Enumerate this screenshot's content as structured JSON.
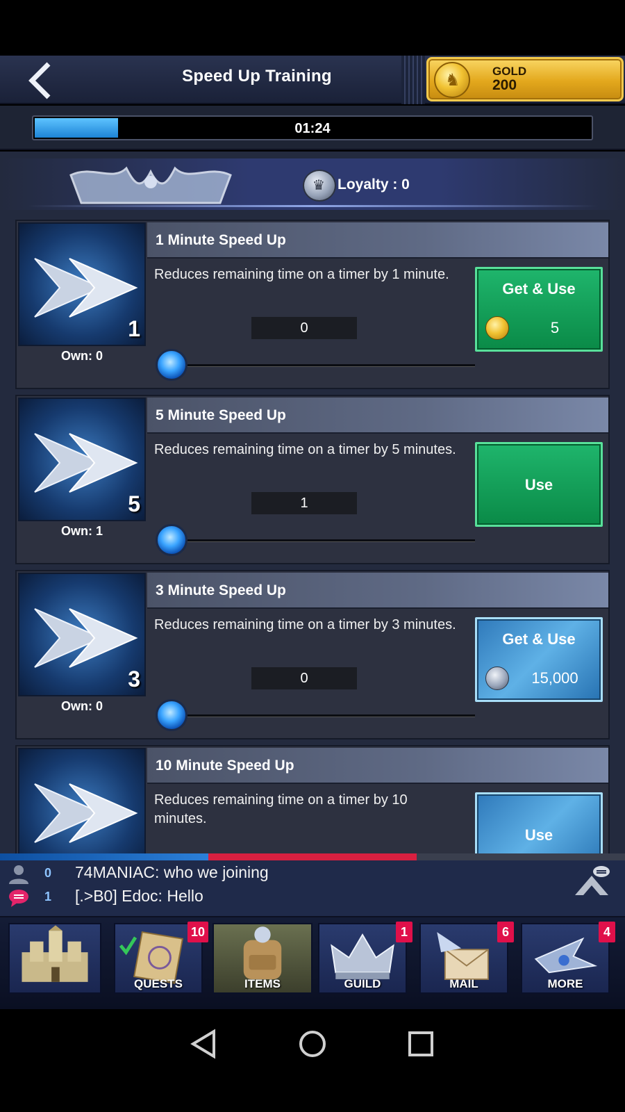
{
  "header": {
    "title": "Speed Up Training",
    "gold_label": "GOLD",
    "gold_value": "200"
  },
  "timer": {
    "text": "01:24",
    "progress_fraction": 0.15
  },
  "loyalty": {
    "text": "Loyalty : 0"
  },
  "items": [
    {
      "title": "1 Minute Speed Up",
      "description": "Reduces remaining time on a timer by 1 minute.",
      "thumb_number": "1",
      "own": "Own:  0",
      "quantity": "0",
      "button": {
        "label": "Get & Use",
        "style": "green",
        "cost_icon": "gold-coin-icon",
        "cost": "5"
      }
    },
    {
      "title": "5 Minute Speed Up",
      "description": "Reduces remaining time on a timer by 5 minutes.",
      "thumb_number": "5",
      "own": "Own:  1",
      "quantity": "1",
      "button": {
        "label": "Use",
        "style": "green"
      }
    },
    {
      "title": "3 Minute Speed Up",
      "description": "Reduces remaining time on a timer by 3 minutes.",
      "thumb_number": "3",
      "own": "Own:  0",
      "quantity": "0",
      "button": {
        "label": "Get & Use",
        "style": "blue",
        "cost_icon": "loyalty-coin-icon",
        "cost": "15,000"
      }
    },
    {
      "title": "10 Minute Speed Up",
      "description": "Reduces remaining time on a timer by 10 minutes.",
      "button": {
        "label": "Use",
        "style": "blue"
      }
    }
  ],
  "chat": {
    "rows": [
      {
        "icon": "person-icon",
        "count": "0",
        "message": "74MANIAC: who we joining"
      },
      {
        "icon": "chat-bubble-icon",
        "count": "1",
        "message": "[.>B0] Edoc: Hello"
      }
    ]
  },
  "nav": [
    {
      "key": "castle",
      "label": "",
      "badge": ""
    },
    {
      "key": "quests",
      "label": "QUESTS",
      "badge": "10"
    },
    {
      "key": "items",
      "label": "ITEMS",
      "badge": ""
    },
    {
      "key": "guild",
      "label": "GUILD",
      "badge": "1"
    },
    {
      "key": "mail",
      "label": "MAIL",
      "badge": "6"
    },
    {
      "key": "more",
      "label": "MORE",
      "badge": "4"
    }
  ],
  "colors": {
    "accent_gold": "#e3a81d",
    "button_green": "#0f9a52",
    "button_blue": "#3f8fcf",
    "badge_red": "#e0104a",
    "chat_red": "#d82040"
  }
}
